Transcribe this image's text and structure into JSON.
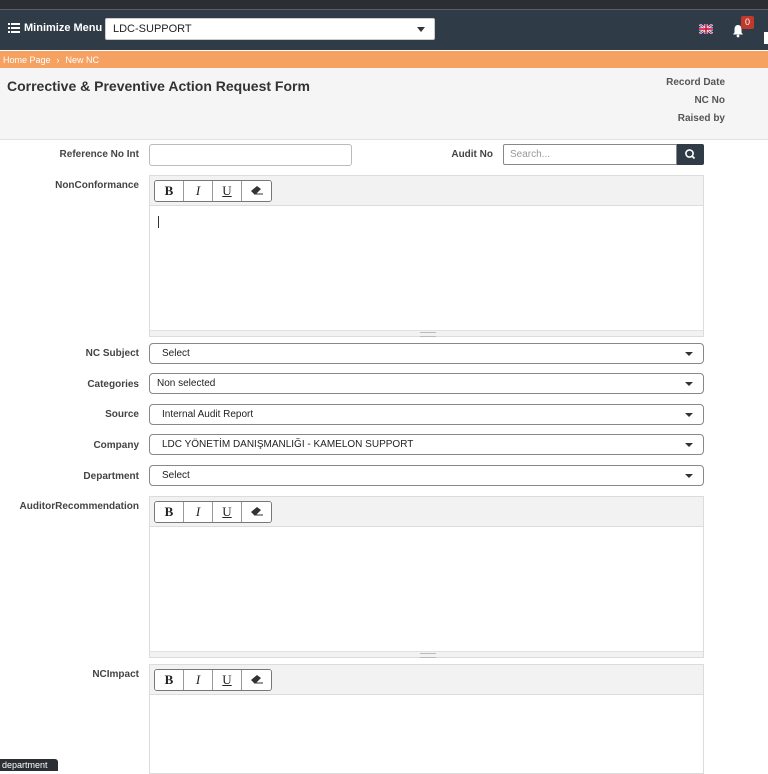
{
  "topbar": {
    "menu_label": "Minimize Menu",
    "site_selected": "LDC-SUPPORT",
    "notification_count": "0"
  },
  "breadcrumb": [
    "Home Page",
    "New NC"
  ],
  "header": {
    "title": "Corrective & Preventive Action Request Form",
    "meta": [
      "Record Date",
      "NC No",
      "Raised by"
    ]
  },
  "form": {
    "reference_label": "Reference No Int",
    "reference_value": "",
    "audit_label": "Audit No",
    "audit_placeholder": "Search...",
    "nonconformance_label": "NonConformance",
    "nc_subject_label": "NC Subject",
    "nc_subject_value": "Select",
    "categories_label": "Categories",
    "categories_value": "Non selected",
    "source_label": "Source",
    "source_value": "Internal Audit Report",
    "company_label": "Company",
    "company_value": "LDC YÖNETİM DANIŞMANLIĞI - KAMELON SUPPORT",
    "department_label": "Department",
    "department_value": "Select",
    "auditor_label": "AuditorRecommendation",
    "ncimpact_label": "NCImpact"
  },
  "editor_toolbar": {
    "bold": "B",
    "italic": "I",
    "underline": "U"
  },
  "tooltip": "department",
  "colors": {
    "topbar": "#2f3b47",
    "breadcrumb": "#f5a162",
    "badge": "#c0392b"
  }
}
